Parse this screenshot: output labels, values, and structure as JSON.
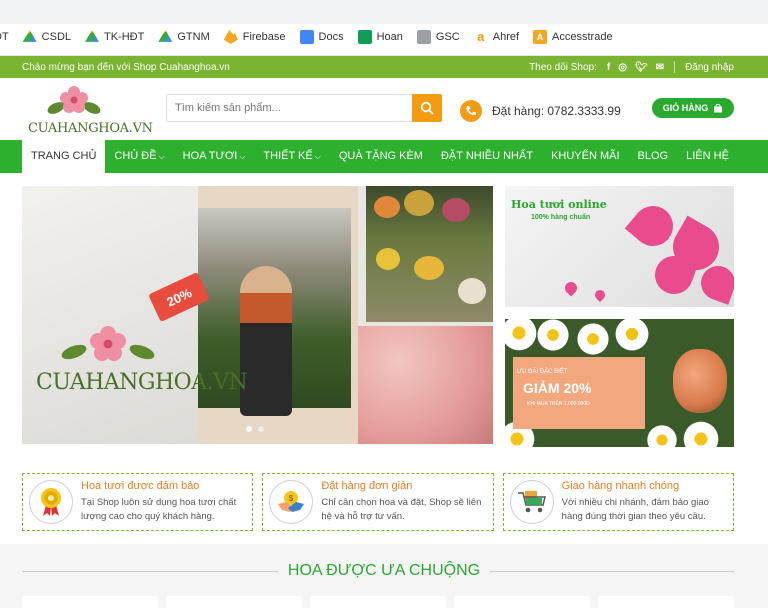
{
  "bookmarks": [
    {
      "label": "DT",
      "icon": "partial-icon"
    },
    {
      "label": "CSDL",
      "icon": "google-drive-icon"
    },
    {
      "label": "TK-HĐT",
      "icon": "google-drive-icon"
    },
    {
      "label": "GTNM",
      "icon": "google-drive-icon"
    },
    {
      "label": "Firebase",
      "icon": "firebase-icon"
    },
    {
      "label": "Docs",
      "icon": "google-docs-icon"
    },
    {
      "label": "Hoan",
      "icon": "google-sheets-icon"
    },
    {
      "label": "GSC",
      "icon": "search-console-icon"
    },
    {
      "label": "Ahref",
      "icon": "ahrefs-icon"
    },
    {
      "label": "Accesstrade",
      "icon": "accesstrade-icon"
    }
  ],
  "topbar": {
    "welcome": "Chào mừng bạn đến với Shop Cuahanghoa.vn",
    "follow": "Theo dõi Shop:",
    "login": "Đăng nhập",
    "social": [
      "facebook-icon",
      "instagram-icon",
      "twitter-icon",
      "email-icon"
    ]
  },
  "header": {
    "logo_text": "CUAHANGHOA.VN",
    "search_placeholder": "Tìm kiếm sản phẩm...",
    "phone": "Đặt hàng: 0782.3333.99",
    "cart": "GIỎ HÀNG"
  },
  "nav": [
    {
      "label": "TRANG CHỦ",
      "active": true,
      "dropdown": false
    },
    {
      "label": "CHỦ ĐỀ",
      "active": false,
      "dropdown": true
    },
    {
      "label": "HOA TƯƠI",
      "active": false,
      "dropdown": true
    },
    {
      "label": "THIẾT KẾ",
      "active": false,
      "dropdown": true
    },
    {
      "label": "QUÀ TẶNG KÈM",
      "active": false,
      "dropdown": false
    },
    {
      "label": "ĐẶT NHIỀU NHẤT",
      "active": false,
      "dropdown": false
    },
    {
      "label": "KHUYẾN MÃI",
      "active": false,
      "dropdown": false
    },
    {
      "label": "BLOG",
      "active": false,
      "dropdown": false
    },
    {
      "label": "LIÊN HỆ",
      "active": false,
      "dropdown": false
    }
  ],
  "hero": {
    "logo_text": "CUAHANGHOA.VN",
    "tag": "20%"
  },
  "banners": {
    "b1_title": "Hoa tươi online",
    "b1_sub": "100% hàng chuẩn",
    "b2_small": "ƯU ĐÃI ĐẶC BIỆT",
    "b2_big": "GIẢM 20%",
    "b2_note": "KHI MUA TRÊN 1.000.000Đ"
  },
  "features": [
    {
      "title": "Hoa tươi được đảm bảo",
      "desc": "Tại Shop luôn sử dụng hoa tươi chất lượng cao cho quý khách hàng.",
      "icon": "quality-medal-icon"
    },
    {
      "title": "Đặt hàng đơn giản",
      "desc": "Chỉ cần chọn hoa và đặt, Shop sẽ liên hệ và hỗ trợ tư vấn.",
      "icon": "handshake-icon"
    },
    {
      "title": "Giao hàng nhanh chóng",
      "desc": "Với nhiều chi nhánh, đảm bảo giao hàng đúng thời gian theo yêu cầu.",
      "icon": "delivery-cart-icon"
    }
  ],
  "section": {
    "title": "HOA ĐƯỢC ƯA CHUỘNG"
  },
  "colors": {
    "brand_green": "#2db02e",
    "light_green": "#7ab531",
    "accent_orange": "#f39c12"
  }
}
